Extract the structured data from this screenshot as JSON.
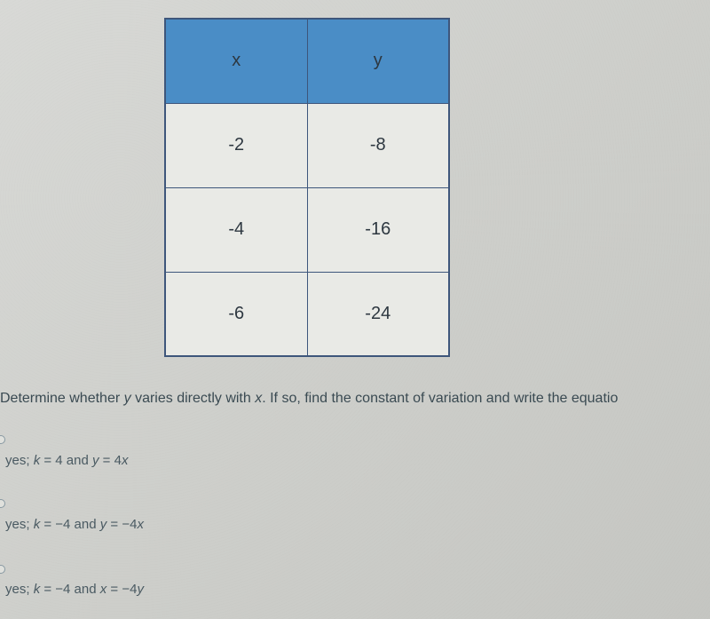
{
  "chart_data": {
    "type": "table",
    "headers": [
      "x",
      "y"
    ],
    "rows": [
      {
        "x": "-2",
        "y": "-8"
      },
      {
        "x": "-4",
        "y": "-16"
      },
      {
        "x": "-6",
        "y": "-24"
      }
    ]
  },
  "question": {
    "prefix": "Determine whether ",
    "var1": "y",
    "mid1": " varies directly with ",
    "var2": "x",
    "suffix": ". If so, find the constant of variation and write the equatio"
  },
  "options": [
    {
      "p1": "yes; ",
      "v1": "k",
      "p2": " = 4 and ",
      "v2": "y",
      "p3": " = 4",
      "v3": "x"
    },
    {
      "p1": "yes; ",
      "v1": "k",
      "p2": " = −4 and ",
      "v2": "y",
      "p3": " = −4",
      "v3": "x"
    },
    {
      "p1": "yes; ",
      "v1": "k",
      "p2": " = −4 and ",
      "v2": "x",
      "p3": " = −4",
      "v3": "y"
    }
  ]
}
